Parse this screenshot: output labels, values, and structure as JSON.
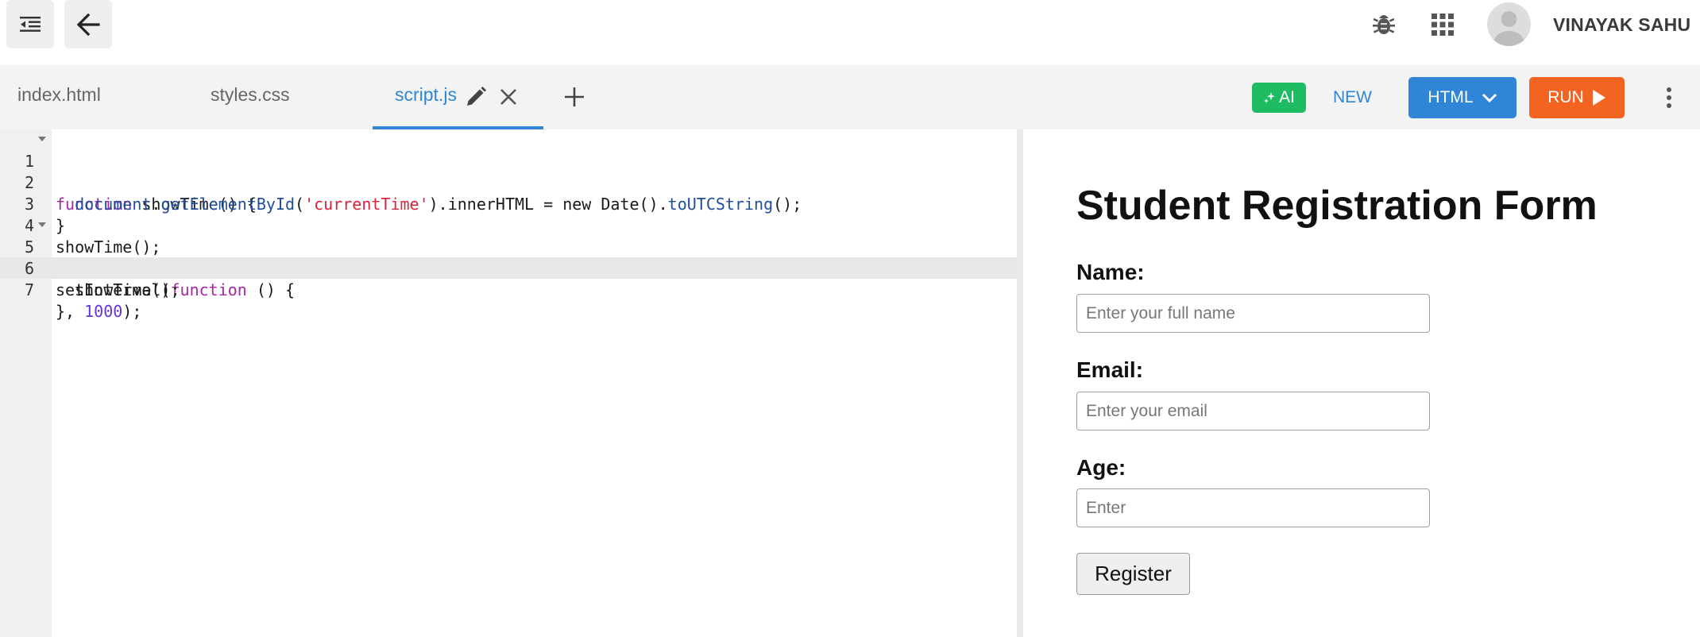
{
  "topbar": {
    "username": "VINAYAK SAHU"
  },
  "tabs": [
    {
      "label": "index.html"
    },
    {
      "label": "styles.css"
    },
    {
      "label": "script.js",
      "active": true
    }
  ],
  "toolbar": {
    "ai_label": "AI",
    "new_label": "NEW",
    "language_label": "HTML",
    "run_label": "RUN"
  },
  "editor": {
    "active_line": 7,
    "lines": [
      {
        "n": "1",
        "fold": true
      },
      {
        "n": "2",
        "fold": false
      },
      {
        "n": "3",
        "fold": false
      },
      {
        "n": "4",
        "fold": false
      },
      {
        "n": "5",
        "fold": true
      },
      {
        "n": "6",
        "fold": false
      },
      {
        "n": "7",
        "fold": false
      }
    ],
    "tokens": {
      "l1_kw": "function",
      "l1_rest": " showTime() {",
      "l2_indent": "  ",
      "l2_obj": "document",
      "l2_a": ".",
      "l2_method": "getElementById",
      "l2_b": "(",
      "l2_str": "'currentTime'",
      "l2_c": ").innerHTML = ",
      "l2_kw": "new",
      "l2_d": " Date().",
      "l2_method2": "toUTCString",
      "l2_e": "();",
      "l3": "}",
      "l4": "showTime();",
      "l5_a": "setInterval(",
      "l5_kw": "function",
      "l5_b": " () {",
      "l6": "  showTime();",
      "l7_a": "}, ",
      "l7_num": "1000",
      "l7_b": ");"
    }
  },
  "preview": {
    "title": "Student Registration Form",
    "name_label": "Name:",
    "name_placeholder": "Enter your full name",
    "email_label": "Email:",
    "email_placeholder": "Enter your email",
    "age_label": "Age:",
    "age_placeholder": "Enter",
    "register_label": "Register"
  },
  "colors": {
    "accent_blue": "#2f86d6",
    "ai_green": "#1dbb62",
    "run_orange": "#f36422"
  },
  "icons": [
    "menu-indent-icon",
    "back-arrow-icon",
    "bug-icon",
    "apps-grid-icon",
    "avatar-icon",
    "pencil-icon",
    "close-icon",
    "plus-icon",
    "sparkle-icon",
    "chevron-down-icon",
    "play-icon",
    "more-vertical-icon"
  ]
}
